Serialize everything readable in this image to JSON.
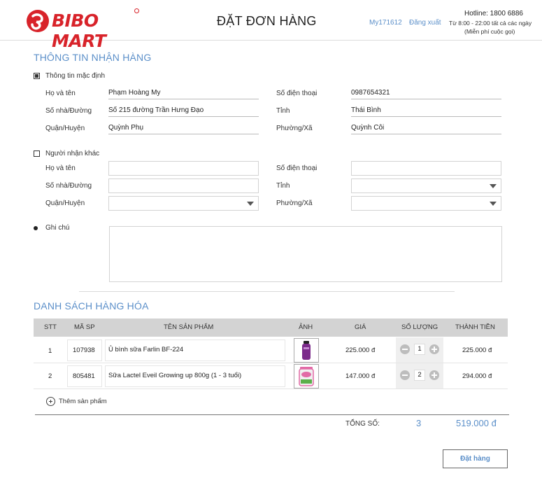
{
  "header": {
    "logo_text": "BIBO MART",
    "title": "ĐẶT ĐƠN HÀNG",
    "username": "My171612",
    "logout": "Đăng xuất",
    "hotline": "Hotline: 1800 6886",
    "hours": "Từ 8:00 - 22:00 tất cả các ngày",
    "free_call": "(Miễn phí cuộc gọi)"
  },
  "receiver": {
    "section_title": "THÔNG TIN NHẬN HÀNG",
    "default_option": {
      "label": "Thông tin mặc định",
      "checked": true,
      "fields": {
        "name_label": "Họ và tên",
        "name_value": "Phạm Hoàng My",
        "phone_label": "Số điện thoại",
        "phone_value": "0987654321",
        "address_label": "Số nhà/Đường",
        "address_value": "Số 215 đường Trần Hưng Đạo",
        "province_label": "Tỉnh",
        "province_value": "Thái Bình",
        "district_label": "Quận/Huyện",
        "district_value": "Quỳnh Phụ",
        "ward_label": "Phường/Xã",
        "ward_value": "Quỳnh Côi"
      }
    },
    "other_option": {
      "label": "Người nhận khác",
      "checked": false,
      "fields": {
        "name_label": "Họ và tên",
        "name_value": "",
        "phone_label": "Số điện thoại",
        "phone_value": "",
        "address_label": "Số nhà/Đường",
        "address_value": "",
        "province_label": "Tỉnh",
        "province_value": "",
        "district_label": "Quận/Huyện",
        "district_value": "",
        "ward_label": "Phường/Xã",
        "ward_value": ""
      }
    },
    "note_label": "Ghi chú",
    "note_value": ""
  },
  "products": {
    "section_title": "DANH SÁCH HÀNG HÓA",
    "columns": [
      "STT",
      "MÃ SP",
      "TÊN SẢN PHẨM",
      "ẢNH",
      "GIÁ",
      "SỐ LƯỢNG",
      "THÀNH TIỀN"
    ],
    "rows": [
      {
        "stt": "1",
        "code": "107938",
        "name": "Ủ bình sữa Farlin BF-224",
        "price": "225.000 đ",
        "qty": "1",
        "total": "225.000 đ"
      },
      {
        "stt": "2",
        "code": "805481",
        "name": "Sữa Lactel Eveil Growing up 800g (1 - 3 tuổi)",
        "price": "147.000 đ",
        "qty": "2",
        "total": "294.000 đ"
      }
    ],
    "add_label": "Thêm sản phẩm",
    "total_label": "TỔNG SỐ:",
    "total_qty": "3",
    "total_amount": "519.000 đ"
  },
  "order_button": "Đặt hàng",
  "colors": {
    "accent": "#5b8fc9",
    "brand_red": "#d8232a",
    "table_header": "#d3d3d3"
  }
}
